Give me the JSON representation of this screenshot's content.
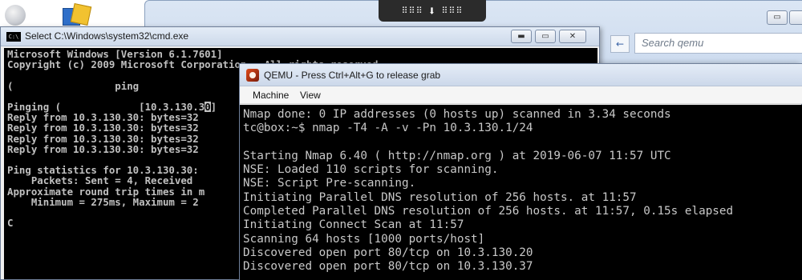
{
  "explorer": {
    "search_placeholder": "Search qemu",
    "back_label": "←",
    "min_label": "▭"
  },
  "remote_bar": {
    "left_dots": "⠿⠿⠿",
    "arrow": "⬇",
    "right_dots": "⠿⠿⠿"
  },
  "cmd": {
    "title": "Select C:\\Windows\\system32\\cmd.exe",
    "icon_text": "C:\\",
    "min_label": "▬",
    "max_label": "▭",
    "close_label": "✕",
    "lines_before_cursor": "Microsoft Windows [Version 6.1.7601]\nCopyright (c) 2009 Microsoft Corporation.  All rights reserved.\n\n(                 ping\n\nPinging (             [10.3.130.3",
    "cursor_char": "0",
    "lines_after_cursor": "]\nReply from 10.3.130.30: bytes=32\nReply from 10.3.130.30: bytes=32\nReply from 10.3.130.30: bytes=32\nReply from 10.3.130.30: bytes=32\n\nPing statistics for 10.3.130.30:\n    Packets: Sent = 4, Received\nApproximate round trip times in m\n    Minimum = 275ms, Maximum = 2\n\nC"
  },
  "qemu": {
    "title": "QEMU - Press Ctrl+Alt+G to release grab",
    "menu": {
      "machine": "Machine",
      "view": "View"
    },
    "console": "Nmap done: 0 IP addresses (0 hosts up) scanned in 3.34 seconds\ntc@box:~$ nmap -T4 -A -v -Pn 10.3.130.1/24\n\nStarting Nmap 6.40 ( http://nmap.org ) at 2019-06-07 11:57 UTC\nNSE: Loaded 110 scripts for scanning.\nNSE: Script Pre-scanning.\nInitiating Parallel DNS resolution of 256 hosts. at 11:57\nCompleted Parallel DNS resolution of 256 hosts. at 11:57, 0.15s elapsed\nInitiating Connect Scan at 11:57\nScanning 64 hosts [1000 ports/host]\nDiscovered open port 80/tcp on 10.3.130.20\nDiscovered open port 80/tcp on 10.3.130.37"
  },
  "colors": {
    "console_bg": "#000000",
    "console_fg": "#c0c0c0",
    "titlebar": "#cdd9ea"
  }
}
